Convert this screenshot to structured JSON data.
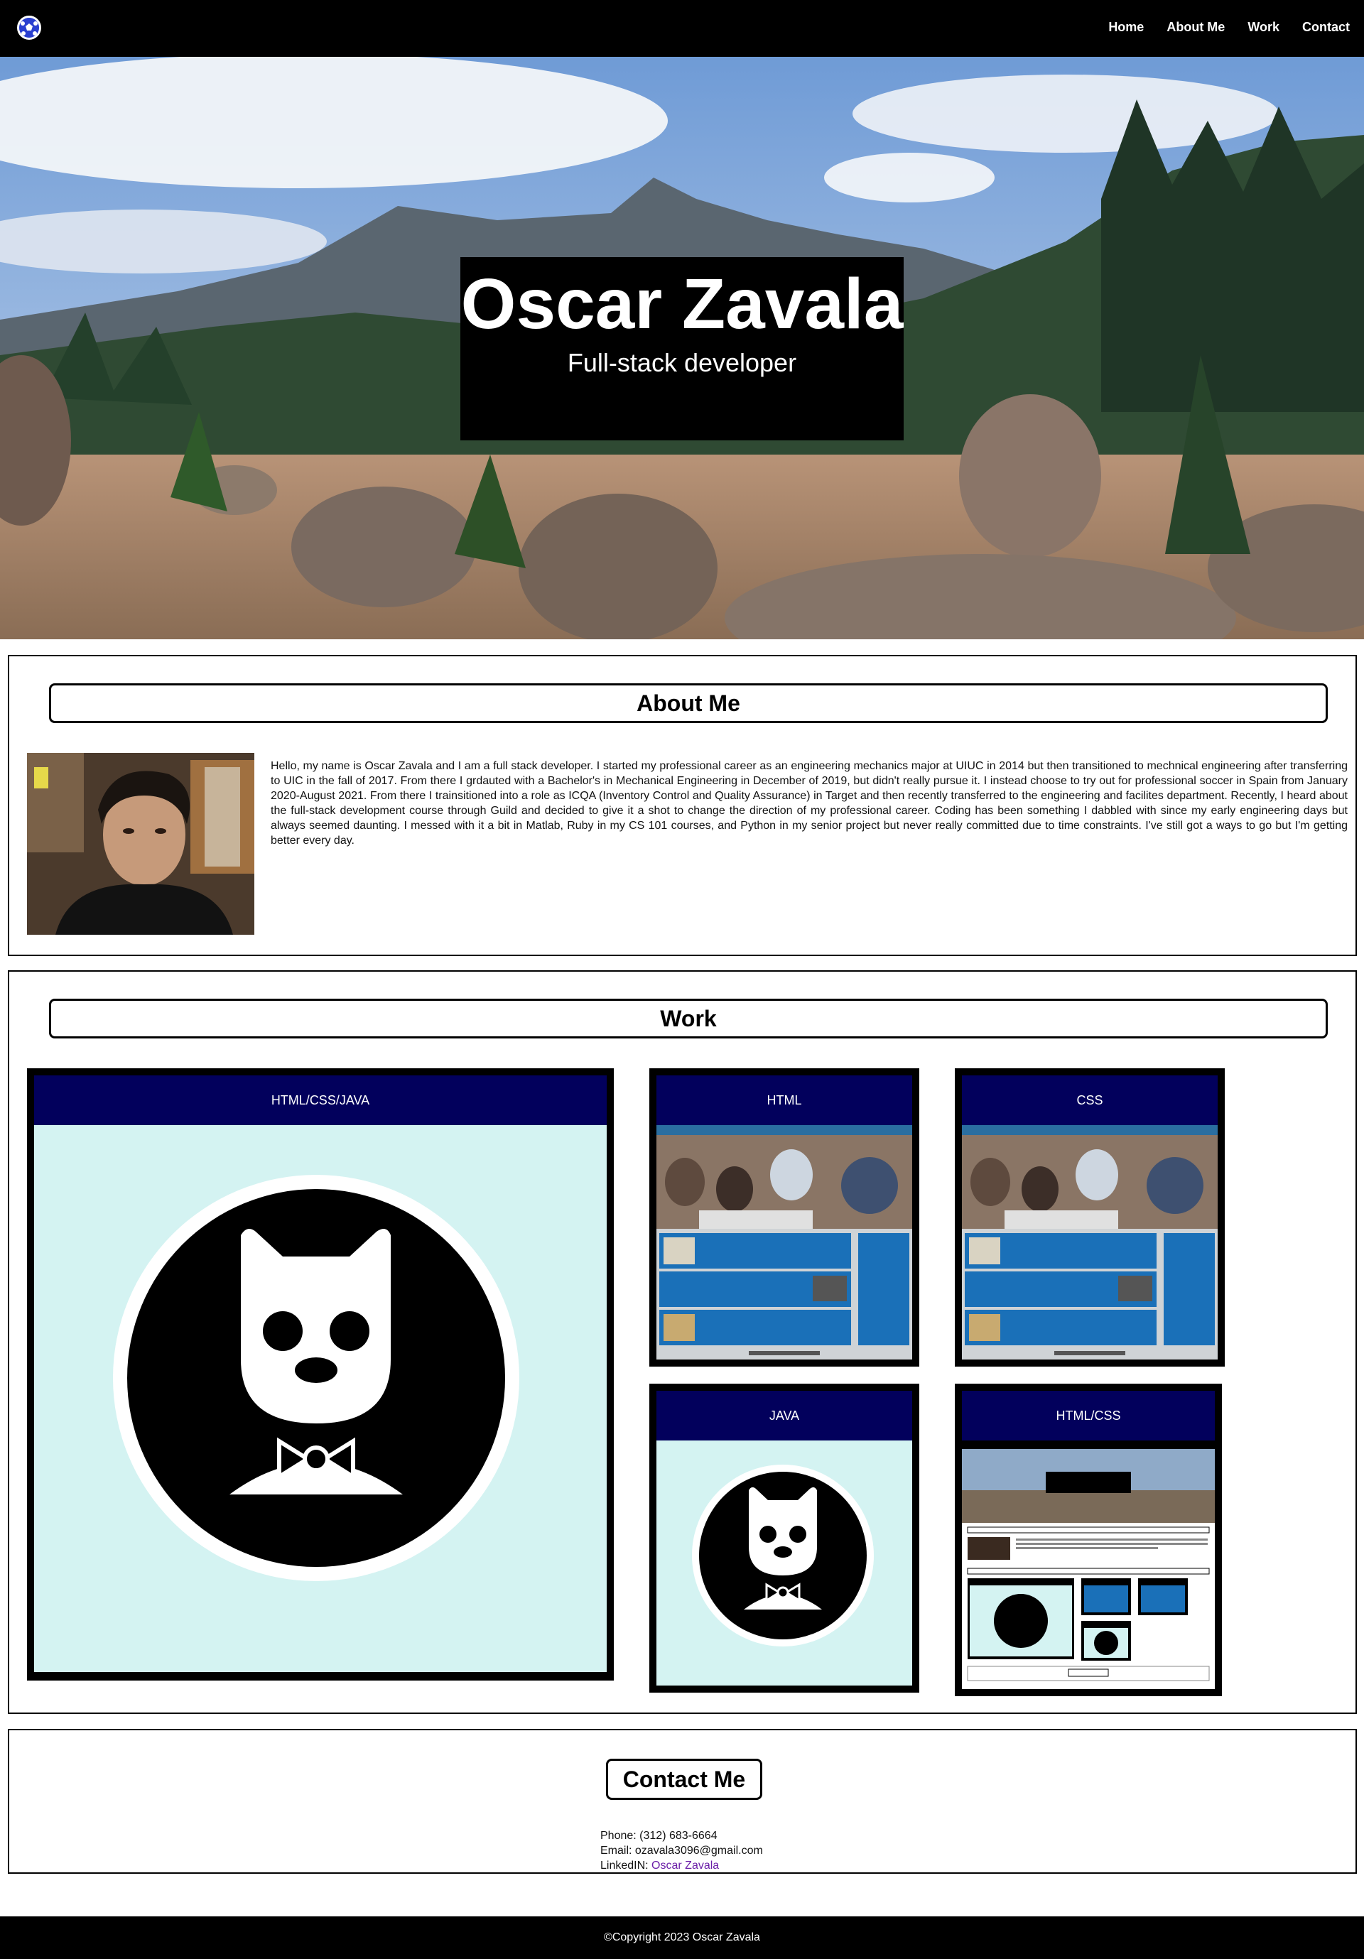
{
  "nav": {
    "logo_icon": "soccer-ball-icon",
    "links": [
      "Home",
      "About Me",
      "Work",
      "Contact"
    ]
  },
  "hero": {
    "name": "Oscar Zavala",
    "role": "Full-stack developer"
  },
  "about": {
    "title": "About Me",
    "text": "Hello, my name is Oscar Zavala and I am a full stack developer. I started my professional career as an engineering mechanics major at UIUC in 2014 but then transitioned to mechnical engineering after transferring to UIC in the fall of 2017. From there I grdauted with a Bachelor's in Mechanical Engineering in December of 2019, but didn't really pursue it. I instead choose to try out for professional soccer in Spain from January 2020-August 2021. From there I trainsitioned into a role as ICQA (Inventory Control and Quality Assurance) in Target and then recently transferred to the engineering and facilites department. Recently, I heard about the full-stack development course through Guild and decided to give it a shot to change the direction of my professional career. Coding has been something I dabbled with since my early engineering days but always seemed daunting. I messed with it a bit in Matlab, Ruby in my CS 101 courses, and Python in my senior project but never really committed due to time constraints. I've still got a ways to go but I'm getting better every day."
  },
  "work": {
    "title": "Work",
    "cards": [
      {
        "label": "HTML/CSS/JAVA"
      },
      {
        "label": "HTML"
      },
      {
        "label": "CSS"
      },
      {
        "label": "JAVA"
      },
      {
        "label": "HTML/CSS"
      }
    ]
  },
  "contact": {
    "title": "Contact Me",
    "phone_label": "Phone:",
    "phone": "(312) 683-6664",
    "email_label": "Email:",
    "email": "ozavala3096@gmail.com",
    "linkedin_label": "LinkedIN:",
    "linkedin": "Oscar Zavala"
  },
  "footer": {
    "text": "©Copyright 2023 Oscar Zavala"
  },
  "colors": {
    "nav_bg": "#000000",
    "card_header": "#02005c",
    "card_body": "#d4f3f2",
    "link": "#6b1fa8"
  }
}
